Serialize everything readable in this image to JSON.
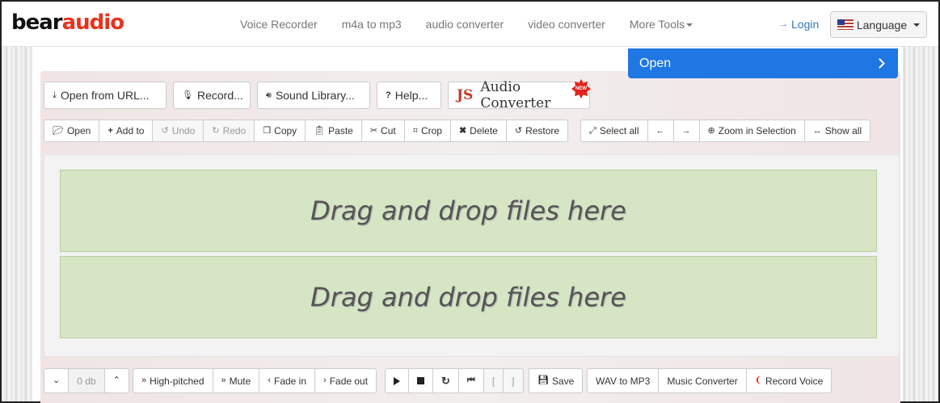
{
  "header": {
    "logo_bear": "bear",
    "logo_audio": "audio",
    "nav": [
      "Voice Recorder",
      "m4a to mp3",
      "audio converter",
      "video converter",
      "More Tools"
    ],
    "login": "Login",
    "language": "Language"
  },
  "popup": {
    "label": "Open"
  },
  "top_buttons": {
    "open_url": "Open from URL...",
    "record": "Record...",
    "sound_library": "Sound Library...",
    "help": "Help...",
    "js_prefix": "JS",
    "js_label": "Audio Converter",
    "new_badge": "NEW"
  },
  "toolbar": {
    "open": "Open",
    "add_to": "Add to",
    "undo": "Undo",
    "redo": "Redo",
    "copy": "Copy",
    "paste": "Paste",
    "cut": "Cut",
    "crop": "Crop",
    "delete": "Delete",
    "restore": "Restore",
    "select_all": "Select all",
    "zoom_selection": "Zoom in Selection",
    "show_all": "Show all"
  },
  "drop_zones": [
    "Drag and drop files here",
    "Drag and drop files here"
  ],
  "bottom": {
    "db_value": "0 db",
    "high_pitched": "High-pitched",
    "mute": "Mute",
    "fade_in": "Fade in",
    "fade_out": "Fade out",
    "bracket_open": "[",
    "bracket_close": "]",
    "save": "Save",
    "wav_to_mp3": "WAV to MP3",
    "music_converter": "Music Converter",
    "record_voice": "Record Voice"
  },
  "colors": {
    "accent": "#1f77e3",
    "brand_red": "#e8321f",
    "drop_bg": "#d6e5c4"
  }
}
